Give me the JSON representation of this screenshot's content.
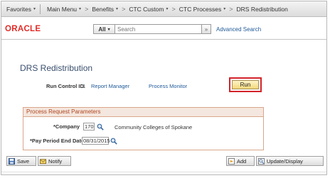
{
  "nav": {
    "favorites": "Favorites",
    "main_menu": "Main Menu",
    "crumb1": "Benefits",
    "crumb2": "CTC Custom",
    "crumb3": "CTC Processes",
    "crumb4": "DRS Redistribution",
    "caret": "▾",
    "arrow": ">"
  },
  "header": {
    "logo": "ORACLE",
    "search_scope": "All",
    "search_placeholder": "Search",
    "go_symbol": "»",
    "advanced_search": "Advanced Search"
  },
  "page": {
    "title": "DRS Redistribution",
    "run_control_label": "Run Control ID",
    "run_control_value": "1",
    "report_manager": "Report Manager",
    "process_monitor": "Process Monitor",
    "run_button": "Run"
  },
  "params": {
    "heading": "Process Request Parameters",
    "company_label": "*Company",
    "company_value": "170",
    "company_desc": "Community Colleges of Spokane",
    "ppe_label": "*Pay Period End Date",
    "ppe_value": "08/31/2015"
  },
  "toolbar": {
    "save": "Save",
    "notify": "Notify",
    "add": "Add",
    "update_display": "Update/Display"
  },
  "colors": {
    "logo": "#e02b27",
    "link": "#1f5a99",
    "highlight": "#d3232a",
    "section_header_text": "#b0461f"
  }
}
